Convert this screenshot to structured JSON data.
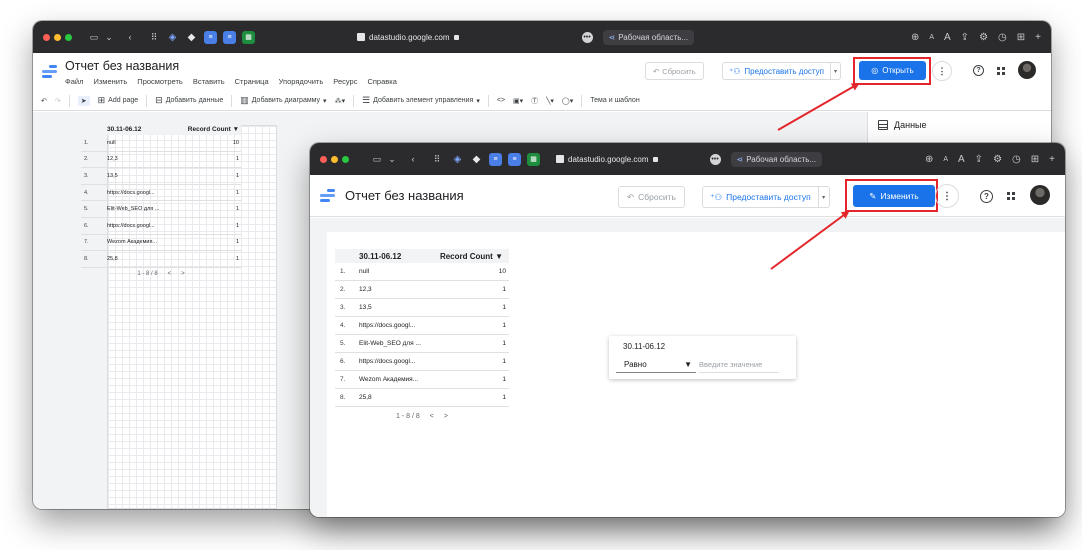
{
  "browser": {
    "url": "datastudio.google.com",
    "workspace_tab": "Рабочая область...",
    "workspace_tab_front": "Рабочая область..."
  },
  "app": {
    "title": "Отчет без названия",
    "menu": [
      "Файл",
      "Изменить",
      "Просмотреть",
      "Вставить",
      "Страница",
      "Упорядочить",
      "Ресурс",
      "Справка"
    ],
    "reset_label": "Сбросить",
    "share_label": "Предоставить доступ",
    "open_label": "Открыть",
    "edit_label": "Изменить"
  },
  "toolbar": {
    "add_page": "Add page",
    "add_data": "Добавить данные",
    "add_chart": "Добавить диаграмму",
    "add_control": "Добавить элемент управления",
    "theme": "Тема и шаблон"
  },
  "panel": {
    "title": "Данные"
  },
  "table": {
    "dimension_header": "30.11-06.12",
    "metric_header": "Record Count",
    "sort_indicator": "▼",
    "rows": [
      {
        "n": "1.",
        "value": "null",
        "count": "10"
      },
      {
        "n": "2.",
        "value": "12,3",
        "count": "1"
      },
      {
        "n": "3.",
        "value": "13,5",
        "count": "1"
      },
      {
        "n": "4.",
        "value": "https://docs.googl...",
        "count": "1"
      },
      {
        "n": "5.",
        "value": "Elit-Web_SEO для ...",
        "count": "1"
      },
      {
        "n": "6.",
        "value": "https://docs.googl...",
        "count": "1"
      },
      {
        "n": "7.",
        "value": "Wezom Академия...",
        "count": "1"
      },
      {
        "n": "8.",
        "value": "25,8",
        "count": "1"
      }
    ],
    "pager": "1 - 8 / 8",
    "pager_prev": "<",
    "pager_next": ">"
  },
  "filter": {
    "label": "30.11-06.12",
    "operator": "Равно",
    "placeholder": "Введите значение"
  },
  "colors": {
    "highlight_red": "#e3262b",
    "primary_blue": "#1a73e8",
    "chrome_dark": "#2b2b2e"
  }
}
